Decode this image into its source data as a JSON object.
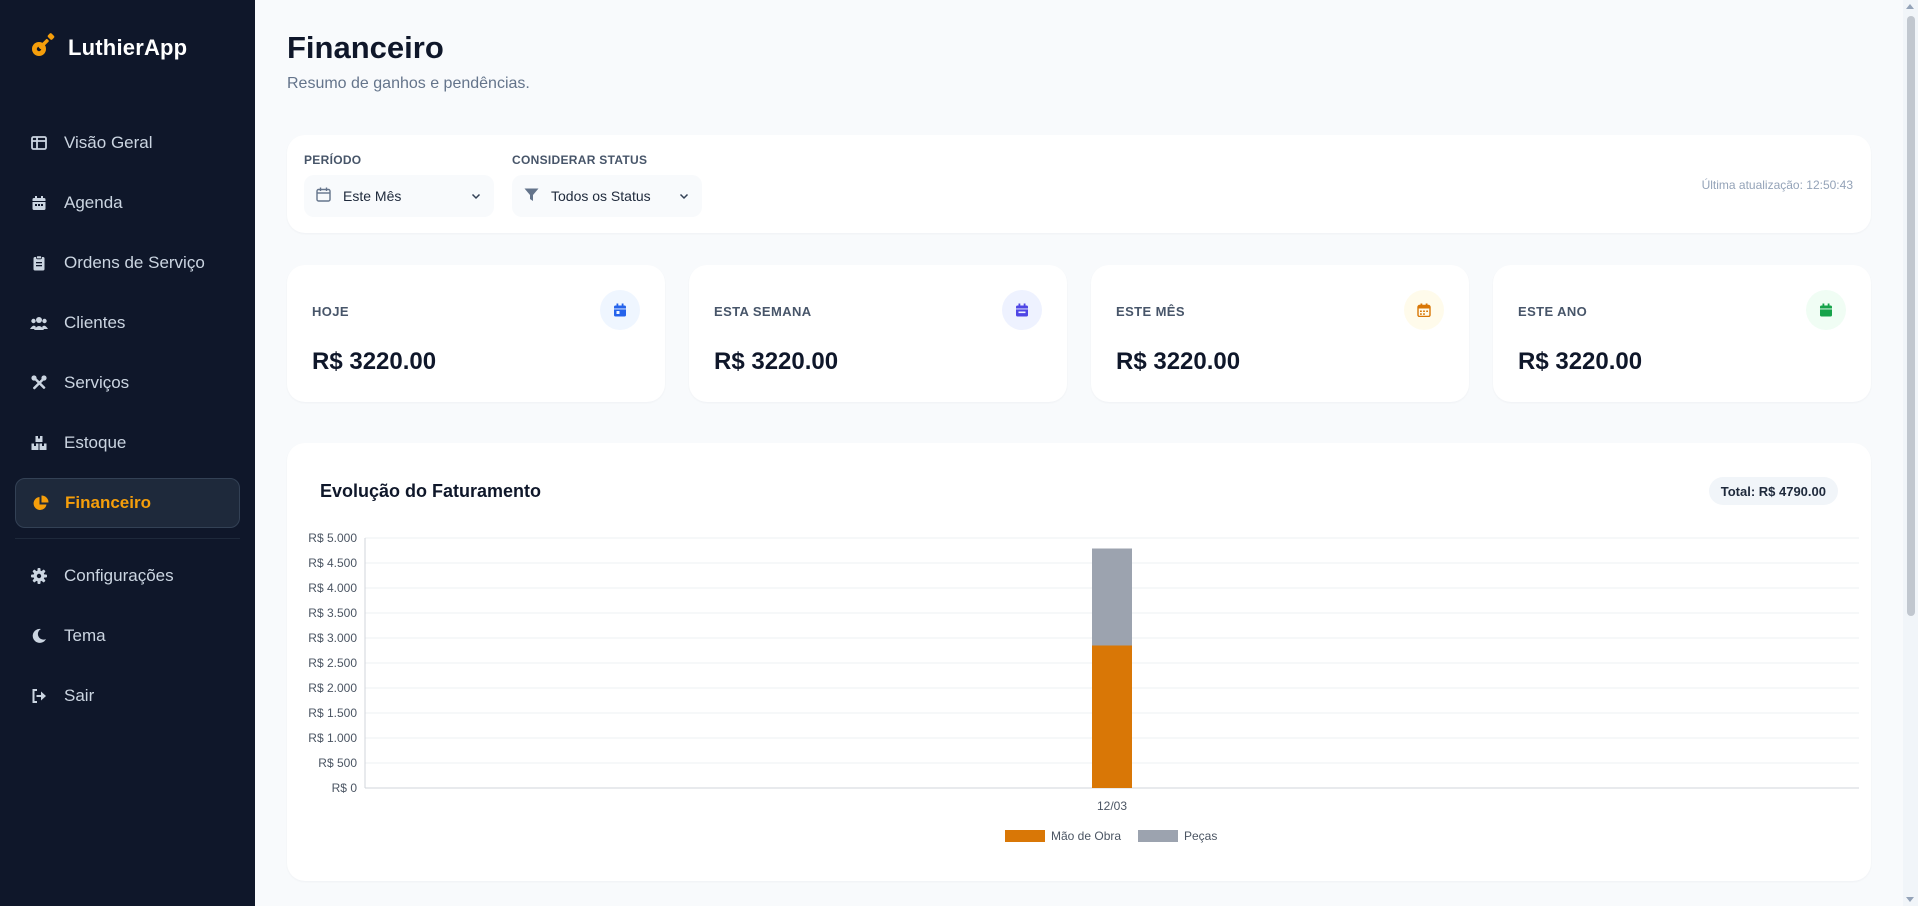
{
  "app": {
    "name": "LuthierApp",
    "logo_icon": "guitar-icon",
    "accent": "#f59e0b"
  },
  "sidebar": {
    "items": [
      {
        "label": "Visão Geral",
        "icon": "layout-icon"
      },
      {
        "label": "Agenda",
        "icon": "calendar-icon"
      },
      {
        "label": "Ordens de Serviço",
        "icon": "clipboard-icon"
      },
      {
        "label": "Clientes",
        "icon": "users-icon"
      },
      {
        "label": "Serviços",
        "icon": "tools-icon"
      },
      {
        "label": "Estoque",
        "icon": "boxes-icon"
      },
      {
        "label": "Financeiro",
        "icon": "pie-chart-icon",
        "active": true
      }
    ],
    "bottom_items": [
      {
        "label": "Configurações",
        "icon": "gear-icon"
      },
      {
        "label": "Tema",
        "icon": "moon-icon"
      },
      {
        "label": "Sair",
        "icon": "logout-icon"
      }
    ]
  },
  "header": {
    "title": "Financeiro",
    "subtitle": "Resumo de ganhos e pendências."
  },
  "filters": {
    "period": {
      "label": "PERÍODO",
      "value": "Este Mês"
    },
    "status": {
      "label": "CONSIDERAR STATUS",
      "value": "Todos os Status"
    },
    "updated": "Última atualização: 12:50:43"
  },
  "stats": [
    {
      "label": "HOJE",
      "value": "R$ 3220.00",
      "color": "#2563eb",
      "bg": "#eff6ff"
    },
    {
      "label": "ESTA SEMANA",
      "value": "R$ 3220.00",
      "color": "#4f46e5",
      "bg": "#eef2ff"
    },
    {
      "label": "ESTE MÊS",
      "value": "R$ 3220.00",
      "color": "#d97706",
      "bg": "#fffbeb"
    },
    {
      "label": "ESTE ANO",
      "value": "R$ 3220.00",
      "color": "#16a34a",
      "bg": "#f0fdf4"
    }
  ],
  "chart_card": {
    "title": "Evolução do Faturamento",
    "total": "Total: R$ 4790.00"
  },
  "chart_data": {
    "type": "bar",
    "stacked": true,
    "categories": [
      "12/03"
    ],
    "series": [
      {
        "name": "Mão de Obra",
        "values": [
          2850
        ],
        "color": "#d97706"
      },
      {
        "name": "Peças",
        "values": [
          1940
        ],
        "color": "#9ca3af"
      }
    ],
    "ylim": [
      0,
      5000
    ],
    "yticks": [
      0,
      500,
      1000,
      1500,
      2000,
      2500,
      3000,
      3500,
      4000,
      4500,
      5000
    ],
    "ytick_labels": [
      "R$ 0",
      "R$ 500",
      "R$ 1.000",
      "R$ 1.500",
      "R$ 2.000",
      "R$ 2.500",
      "R$ 3.000",
      "R$ 3.500",
      "R$ 4.000",
      "R$ 4.500",
      "R$ 5.000"
    ],
    "grid": true,
    "legend": "bottom"
  }
}
